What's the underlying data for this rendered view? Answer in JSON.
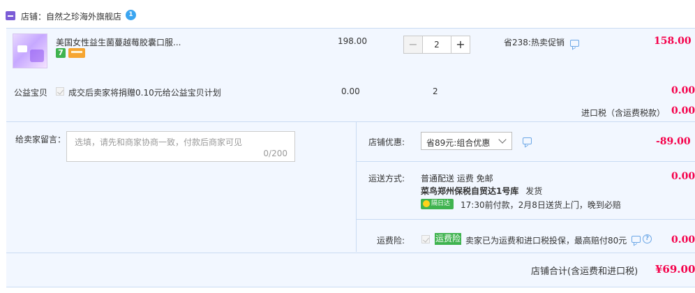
{
  "shop": {
    "label": "店铺：自然之珍海外旗舰店",
    "badge": "1"
  },
  "item": {
    "title": "美国女性益生菌蔓越莓胶囊口服...",
    "tag_seven": "7",
    "unit_price": "198.00",
    "quantity": "2",
    "minus": "−",
    "plus": "+",
    "promo": "省238:热卖促销",
    "total": "158.00"
  },
  "charity": {
    "label": "公益宝贝",
    "text": "成交后卖家将捐赠0.10元给公益宝贝计划",
    "price": "0.00",
    "quantity": "2",
    "total": "0.00"
  },
  "tax": {
    "label": "进口税（含运费税款）",
    "value": "0.00"
  },
  "message": {
    "label": "给卖家留言：",
    "placeholder": "选填，请先和商家协商一致，付款后商家可见",
    "count": "0/200"
  },
  "discount": {
    "label": "店铺优惠:",
    "selected": "省89元:组合优惠",
    "value": "-89.00"
  },
  "shipping": {
    "label": "运送方式:",
    "line1": "普通配送 运费 免邮",
    "warehouse": "菜鸟郑州保税自贸达1号库",
    "warehouse_note": "发货",
    "speed_badge": "隔日达",
    "eta": "17:30前付款，2月8日送货上门，晚到必赔",
    "value": "0.00"
  },
  "insurance": {
    "label": "运费险:",
    "tag": "运费险",
    "text": "卖家已为运费和进口税投保，最高赔付80元",
    "help": "?",
    "value": "0.00"
  },
  "summary": {
    "label": "店铺合计(含运费和进口税)",
    "total": "¥69.00"
  },
  "colors": {
    "accent_red": "#f5004a",
    "panel_bg": "#f2f7ff",
    "green_tag": "#3fb34f",
    "link_blue": "#6aa6e6"
  }
}
